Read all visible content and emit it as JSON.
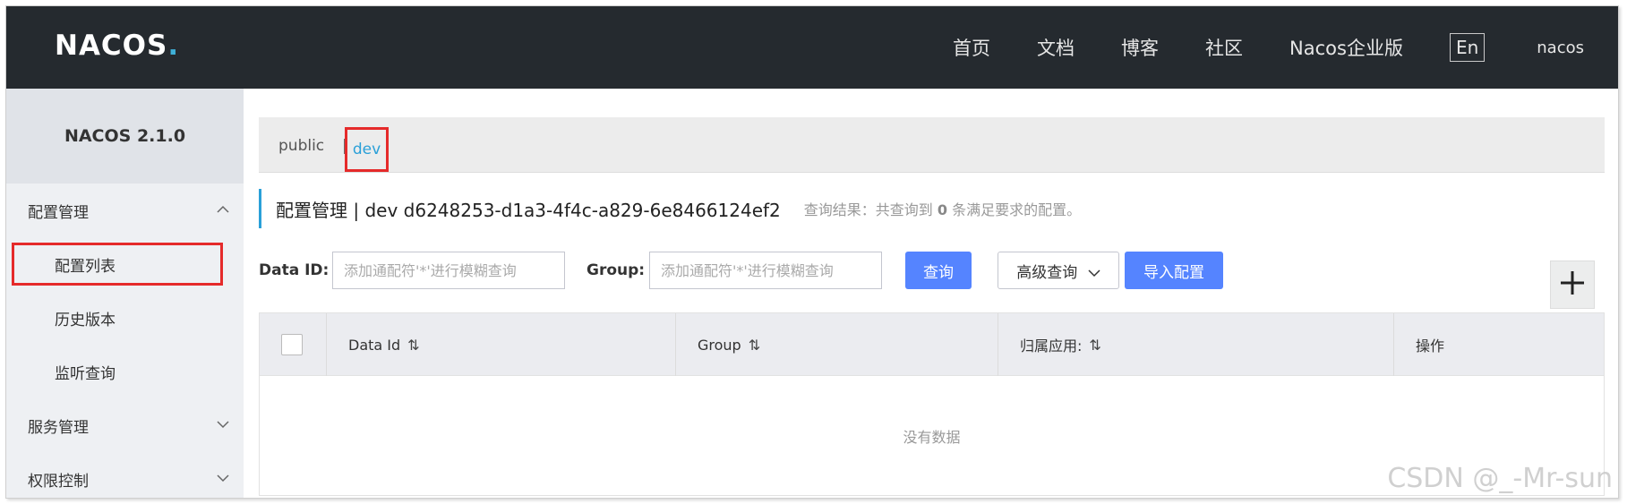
{
  "header": {
    "logo_text": "NACOS",
    "logo_dot": ".",
    "nav": [
      "首页",
      "文档",
      "博客",
      "社区",
      "Nacos企业版"
    ],
    "lang_button": "En",
    "user": "nacos"
  },
  "sidebar": {
    "version": "NACOS 2.1.0",
    "groups": [
      {
        "label": "配置管理",
        "expanded": true
      },
      {
        "label": "服务管理",
        "expanded": false
      },
      {
        "label": "权限控制",
        "expanded": false
      }
    ],
    "config_items": [
      "配置列表",
      "历史版本",
      "监听查询"
    ],
    "active_item": "配置列表"
  },
  "namespaces": {
    "public": "public",
    "separator": "|",
    "dev": "dev",
    "selected": "dev"
  },
  "title": {
    "main": "配置管理  |  dev  d6248253-d1a3-4f4c-a829-6e8466124ef2",
    "result_prefix": "查询结果：共查询到",
    "result_count": "0",
    "result_suffix": "条满足要求的配置。"
  },
  "search": {
    "data_id_label": "Data ID:",
    "data_id_placeholder": "添加通配符'*'进行模糊查询",
    "group_label": "Group:",
    "group_placeholder": "添加通配符'*'进行模糊查询",
    "query_button": "查询",
    "advanced_button": "高级查询",
    "import_button": "导入配置",
    "add_button": "+"
  },
  "table": {
    "columns": [
      "Data Id",
      "Group",
      "归属应用:",
      "操作"
    ],
    "sort_icon": "⇅",
    "rows": [],
    "empty_text": "没有数据"
  },
  "watermark": "CSDN @_-Mr-sun",
  "colors": {
    "header_bg": "#252a2f",
    "accent_blue": "#2aa0d8",
    "primary_button": "#5584ff",
    "highlight_red": "#e52a2a"
  }
}
